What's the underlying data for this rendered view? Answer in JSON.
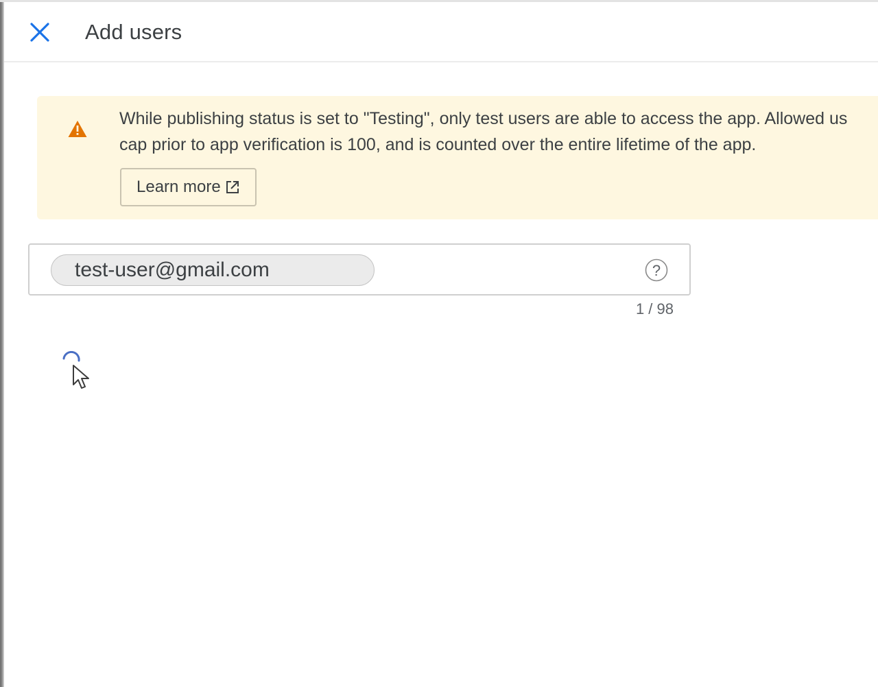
{
  "header": {
    "title": "Add users",
    "close_icon": "close-icon"
  },
  "banner": {
    "icon": "warning-icon",
    "line1": "While publishing status is set to \"Testing\", only test users are able to access the app. Allowed us",
    "line2": "cap prior to app verification is 100, and is counted over the entire lifetime of the app.",
    "learn_more_label": "Learn more",
    "learn_more_icon": "external-link-icon",
    "background_color": "#fef7e0",
    "icon_color": "#e37400"
  },
  "users_field": {
    "chips": [
      {
        "label": "test-user@gmail.com"
      }
    ],
    "help_icon": "help-icon",
    "counter": "1 / 98"
  },
  "status": {
    "loading_icon": "loading-spinner-icon"
  },
  "colors": {
    "accent": "#1a73e8",
    "text": "#3c4043"
  }
}
